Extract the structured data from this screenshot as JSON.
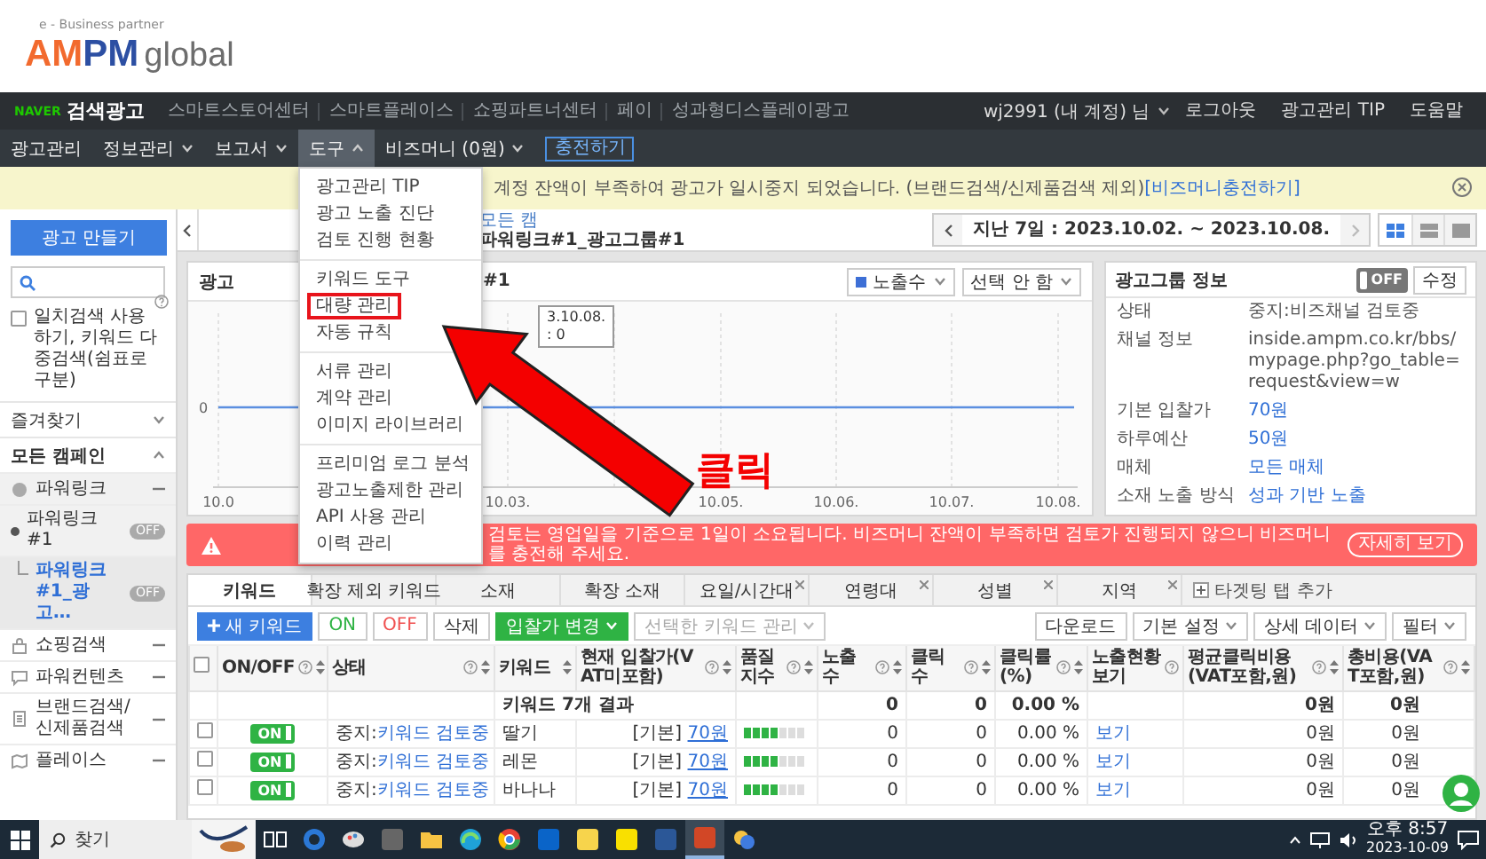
{
  "logo": {
    "tagline": "e - Business partner",
    "brand": "AMPM",
    "suffix": "global"
  },
  "top_bar": {
    "service": "NAVER",
    "title": "검색광고",
    "links": [
      "스마트스토어센터",
      "스마트플레이스",
      "쇼핑파트너센터",
      "페이",
      "성과형디스플레이광고"
    ],
    "account": "wj2991 (내 계정) 님",
    "account_links": [
      "로그아웃",
      "광고관리 TIP",
      "도움말"
    ]
  },
  "nav": {
    "items": [
      {
        "label": "광고관리",
        "has_menu": false,
        "selected": false
      },
      {
        "label": "정보관리",
        "has_menu": true,
        "selected": false
      },
      {
        "label": "보고서",
        "has_menu": true,
        "selected": false
      },
      {
        "label": "도구",
        "has_menu": true,
        "selected": true
      },
      {
        "label": "비즈머니 (0원)",
        "has_menu": true,
        "selected": false
      }
    ],
    "charge_button": "충전하기"
  },
  "notice": {
    "text": "계정 잔액이 부족하여 광고가 일시중지 되었습니다. (브랜드검색/신제품검색 제외)",
    "link": "[비즈머니충전하기]"
  },
  "tools_menu": {
    "groups": [
      {
        "items": [
          {
            "label": "광고관리 TIP",
            "highlighted": false
          },
          {
            "label": "광고 노출 진단",
            "highlighted": false
          },
          {
            "label": "검토 진행 현황",
            "highlighted": false
          }
        ]
      },
      {
        "items": [
          {
            "label": "키워드 도구",
            "highlighted": false
          },
          {
            "label": "대량 관리",
            "highlighted": true
          },
          {
            "label": "자동 규칙",
            "highlighted": false
          }
        ]
      },
      {
        "items": [
          {
            "label": "서류 관리",
            "highlighted": false
          },
          {
            "label": "계약 관리",
            "highlighted": false
          },
          {
            "label": "이미지 라이브러리",
            "highlighted": false
          }
        ]
      },
      {
        "items": [
          {
            "label": "프리미엄 로그 분석",
            "highlighted": false
          },
          {
            "label": "광고노출제한 관리",
            "highlighted": false
          },
          {
            "label": "API 사용 관리",
            "highlighted": false
          },
          {
            "label": "이력 관리",
            "highlighted": false
          }
        ]
      }
    ]
  },
  "annotation": {
    "label": "클릭"
  },
  "sidebar": {
    "create_button": "광고 만들기",
    "exact_match": {
      "label": "일치검색 사용 하기, 키워드 다중검색(쉼표로 구분)",
      "checked": false
    },
    "favorites": {
      "label": "즐겨찾기",
      "expanded": false
    },
    "campaigns": {
      "label": "모든 캠페인",
      "expanded": true,
      "groups": [
        {
          "kind": "powerlink",
          "label": "파워링크",
          "expanded": true,
          "children": [
            {
              "label": "파워링크#1",
              "badge": "OFF",
              "selected": false,
              "children": [
                {
                  "label": "파워링크#1_광고…",
                  "badge": "OFF",
                  "selected": true
                }
              ]
            }
          ]
        },
        {
          "kind": "shopping",
          "label": "쇼핑검색",
          "expanded": true
        },
        {
          "kind": "content",
          "label": "파워컨텐츠",
          "expanded": true
        },
        {
          "kind": "brand",
          "label": "브랜드검색/신제품검색",
          "expanded": true
        },
        {
          "kind": "place",
          "label": "플레이스",
          "expanded": true
        }
      ]
    }
  },
  "page": {
    "breadcrumb": "모든 캠",
    "title": "파워링크#1_광고그룹#1",
    "date_range": "지난 7일 : 2023.10.02. ~ 2023.10.08.",
    "views": [
      {
        "selected": true
      },
      {
        "selected": false
      },
      {
        "selected": false
      }
    ]
  },
  "chart": {
    "title": "광고",
    "title_end": "#1",
    "metric": "노출수",
    "compare": "선택 안 함",
    "y_label": "0",
    "x_labels": [
      "10.0",
      "10.03.",
      "10.05.",
      "10.06.",
      "10.07.",
      "10.08."
    ],
    "tooltip": [
      "3.10.08.",
      ": 0"
    ]
  },
  "info": {
    "title": "광고그룹 정보",
    "toggle": {
      "on": false,
      "label": "OFF"
    },
    "edit_button": "수정",
    "rows": [
      {
        "label": "상태",
        "value": "중지:비즈채널 검토중",
        "kind": "text"
      },
      {
        "label": "채널 정보",
        "value": "inside.ampm.co.kr/bbs/mypage.php?go_table=request&view=w",
        "kind": "text"
      },
      {
        "label": "기본 입찰가",
        "value": "70원",
        "kind": "link"
      },
      {
        "label": "하루예산",
        "value": "50원",
        "kind": "link"
      },
      {
        "label": "매체",
        "value": "모든 매체",
        "kind": "link"
      },
      {
        "label": "소재 노출 방식",
        "value": "성과 기반 노출",
        "kind": "link"
      }
    ]
  },
  "alert": {
    "text": "검토는 영업일을 기준으로 1일이 소요됩니다. 비즈머니 잔액이 부족하면 검토가 진행되지 않으니 비즈머니를 충전해 주세요.",
    "button": "자세히 보기"
  },
  "tabs": [
    {
      "label": "키워드",
      "selected": true,
      "closable": false
    },
    {
      "label": "확장 제외 키워드",
      "selected": false,
      "closable": false
    },
    {
      "label": "소재",
      "selected": false,
      "closable": false
    },
    {
      "label": "확장 소재",
      "selected": false,
      "closable": false
    },
    {
      "label": "요일/시간대",
      "selected": false,
      "closable": true
    },
    {
      "label": "연령대",
      "selected": false,
      "closable": true
    },
    {
      "label": "성별",
      "selected": false,
      "closable": true
    },
    {
      "label": "지역",
      "selected": false,
      "closable": true
    }
  ],
  "add_tab": "타겟팅 탭 추가",
  "toolbar": {
    "left": [
      {
        "label": "새 키워드",
        "kind": "primary"
      },
      {
        "label": "ON",
        "kind": "on"
      },
      {
        "label": "OFF",
        "kind": "off"
      },
      {
        "label": "삭제",
        "kind": "plain"
      },
      {
        "label": "입찰가 변경",
        "kind": "accent"
      },
      {
        "label": "선택한 키워드 관리",
        "kind": "disabled"
      }
    ],
    "right": [
      {
        "label": "다운로드",
        "has_menu": false
      },
      {
        "label": "기본 설정",
        "has_menu": true
      },
      {
        "label": "상세 데이터",
        "has_menu": true
      },
      {
        "label": "필터",
        "has_menu": true
      }
    ]
  },
  "table": {
    "select_all": {
      "checked": false
    },
    "columns": [
      {
        "label": "ON/OFF",
        "help": true,
        "sortable": true
      },
      {
        "label": "상태",
        "help": true,
        "sortable": true
      },
      {
        "label": "키워드",
        "help": false,
        "sortable": true
      },
      {
        "label": "현재 입찰가(VAT미포함)",
        "help": true,
        "sortable": true
      },
      {
        "label": "품질지수",
        "help": true,
        "sortable": true
      },
      {
        "label": "노출수",
        "help": true,
        "sortable": true
      },
      {
        "label": "클릭수",
        "help": true,
        "sortable": true
      },
      {
        "label": "클릭률(%)",
        "help": true,
        "sortable": true
      },
      {
        "label": "노출현황보기",
        "help": true,
        "sortable": false
      },
      {
        "label": "평균클릭비용(VAT포함,원)",
        "help": true,
        "sortable": true
      },
      {
        "label": "총비용(VAT포함,원)",
        "help": true,
        "sortable": true
      }
    ],
    "summary": {
      "label": "키워드 7개 결과",
      "impressions": "0",
      "clicks": "0",
      "ctr": "0.00 %",
      "avg_cpc": "0원",
      "cost": "0원"
    },
    "rows": [
      {
        "checked": false,
        "toggle": {
          "on": true,
          "label": "ON"
        },
        "status": "중지:",
        "status_link": "키워드 검토중",
        "keyword": "딸기",
        "bid_type": "[기본]",
        "bid": "70원",
        "quality": {
          "level": 0.57
        },
        "impressions": "0",
        "clicks": "0",
        "ctr": "0.00 %",
        "exposure": "보기",
        "avg_cpc": "0원",
        "cost": "0원"
      },
      {
        "checked": false,
        "toggle": {
          "on": true,
          "label": "ON"
        },
        "status": "중지:",
        "status_link": "키워드 검토중",
        "keyword": "레몬",
        "bid_type": "[기본]",
        "bid": "70원",
        "quality": {
          "level": 0.57
        },
        "impressions": "0",
        "clicks": "0",
        "ctr": "0.00 %",
        "exposure": "보기",
        "avg_cpc": "0원",
        "cost": "0원"
      },
      {
        "checked": false,
        "toggle": {
          "on": true,
          "label": "ON"
        },
        "status": "중지:",
        "status_link": "키워드 검토중",
        "keyword": "바나나",
        "bid_type": "[기본]",
        "bid": "70원",
        "quality": {
          "level": 0.57
        },
        "impressions": "0",
        "clicks": "0",
        "ctr": "0.00 %",
        "exposure": "보기",
        "avg_cpc": "0원",
        "cost": "0원"
      }
    ]
  },
  "taskbar": {
    "search": "찾기",
    "time": "오후 8:57",
    "date": "2023-10-09"
  }
}
